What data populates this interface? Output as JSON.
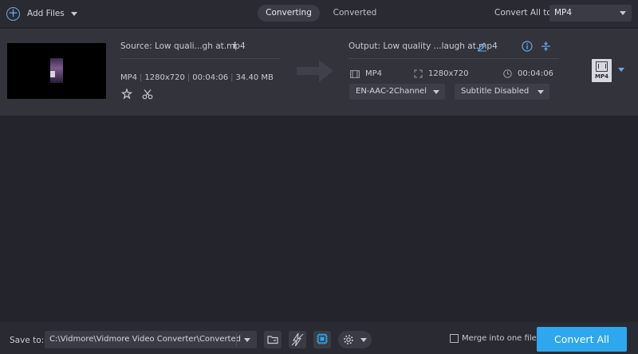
{
  "toolbar": {
    "add_files_label": "Add Files",
    "add_icon": "plus-circle-icon"
  },
  "tabs": [
    {
      "label": "Converting",
      "active": true
    },
    {
      "label": "Converted",
      "active": false
    }
  ],
  "convert_all": {
    "label": "Convert All to:",
    "value": "MP4"
  },
  "file": {
    "source": "Source: Low quali...gh at.mp4",
    "info_glyph": "i",
    "format": "MP4",
    "resolution": "1280x720",
    "duration": "00:04:06",
    "size": "34.40 MB",
    "output": "Output: Low quality ...laugh at.mp4",
    "out_format": "MP4",
    "out_resolution": "1280x720",
    "out_duration": "00:04:06",
    "audio_track": "EN-AAC-2Channel",
    "subtitle": "Subtitle Disabled",
    "format_badge": "MP4"
  },
  "bottom": {
    "save_label": "Save to:",
    "save_path": "C:\\Vidmore\\Vidmore Video Converter\\Converted",
    "merge_label": "Merge into one file",
    "merge_checked": false,
    "convert_label": "Convert All"
  },
  "colors": {
    "accent": "#2ea7ee",
    "background": "#24252c",
    "card": "#32333b"
  }
}
